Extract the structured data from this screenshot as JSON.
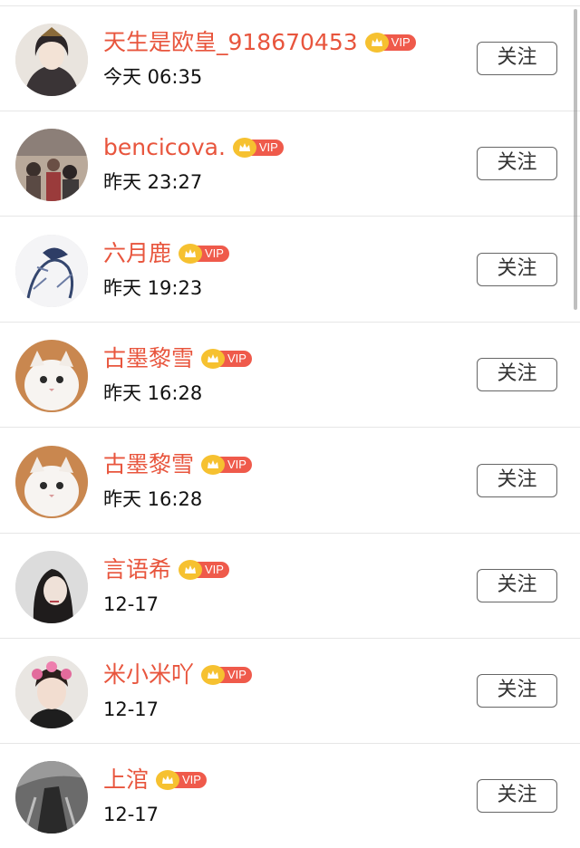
{
  "list": {
    "follow_label": "关注",
    "vip_label": "VIP",
    "items": [
      {
        "name": "天生是欧皇_918670453",
        "time": "今天 06:35",
        "avatar": "anime-character-avatar"
      },
      {
        "name": "bencicova.",
        "time": "昨天 23:27",
        "avatar": "crowd-photo-avatar"
      },
      {
        "name": "六月鹿",
        "time": "昨天 19:23",
        "avatar": "ink-sketch-avatar"
      },
      {
        "name": "古墨黎雪",
        "time": "昨天 16:28",
        "avatar": "white-cat-avatar"
      },
      {
        "name": "古墨黎雪",
        "time": "昨天 16:28",
        "avatar": "white-cat-avatar"
      },
      {
        "name": "言语希",
        "time": "12-17",
        "avatar": "woman-portrait-avatar"
      },
      {
        "name": "米小米吖",
        "time": "12-17",
        "avatar": "girl-with-flowers-avatar"
      },
      {
        "name": "上涫",
        "time": "12-17",
        "avatar": "dark-figure-avatar"
      }
    ]
  },
  "colors": {
    "name": "#e8553d",
    "vip_tag": "#ef5a4b",
    "crown": "#f6c130",
    "divider": "#e6e6e6",
    "button_border": "#666666"
  }
}
